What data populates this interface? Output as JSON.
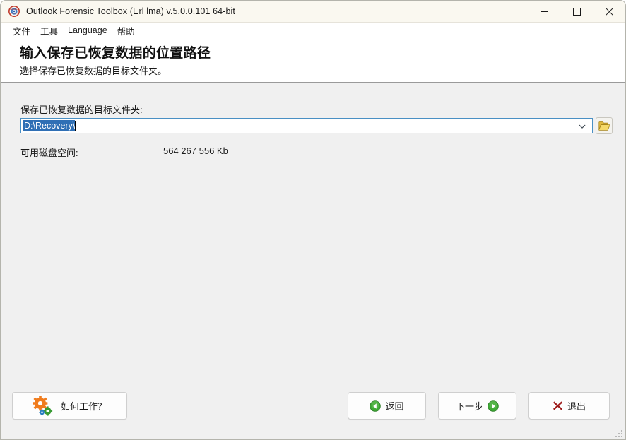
{
  "window": {
    "title": "Outlook Forensic Toolbox (Erl lma) v.5.0.0.101 64-bit",
    "app_icon": "outlook-target-icon",
    "minimize_label": "—",
    "maximize_label": "□",
    "close_label": "✕"
  },
  "menubar": {
    "items": [
      {
        "label": "文件",
        "name": "menu-file"
      },
      {
        "label": "工具",
        "name": "menu-tools"
      },
      {
        "label": "Language",
        "name": "menu-language"
      },
      {
        "label": "帮助",
        "name": "menu-help"
      }
    ]
  },
  "header": {
    "title": "输入保存已恢复数据的位置路径",
    "subtitle": "选择保存已恢复数据的目标文件夹。"
  },
  "form": {
    "path_label": "保存已恢复数据的目标文件夹:",
    "path_value": "D:\\Recovery\\",
    "path_placeholder": "D:\\Recovery\\",
    "browse_icon": "folder-open-icon",
    "dropdown_icon": "chevron-down-icon",
    "disk_label": "可用磁盘空间:",
    "disk_value": "564 267 556 Kb"
  },
  "footer": {
    "howto_label": "如何工作？",
    "howto_icon": "gears-icon",
    "back_label": "返回",
    "back_icon": "arrow-left-circle-icon",
    "next_label": "下一步",
    "next_icon": "arrow-right-circle-icon",
    "exit_label": "退出",
    "exit_icon": "cross-icon"
  },
  "colors": {
    "titlebar_bg": "#faf8f0",
    "content_bg": "#f0f0f0",
    "selection_blue": "#2f6fb5",
    "combo_border": "#4a90c4",
    "gear_orange": "#f07c1e",
    "gear_green": "#3a9b35",
    "gear_blue": "#2a7fc1",
    "nav_green": "#3faa36",
    "exit_red": "#9e1b1b",
    "folder_yellow": "#e8c254"
  }
}
